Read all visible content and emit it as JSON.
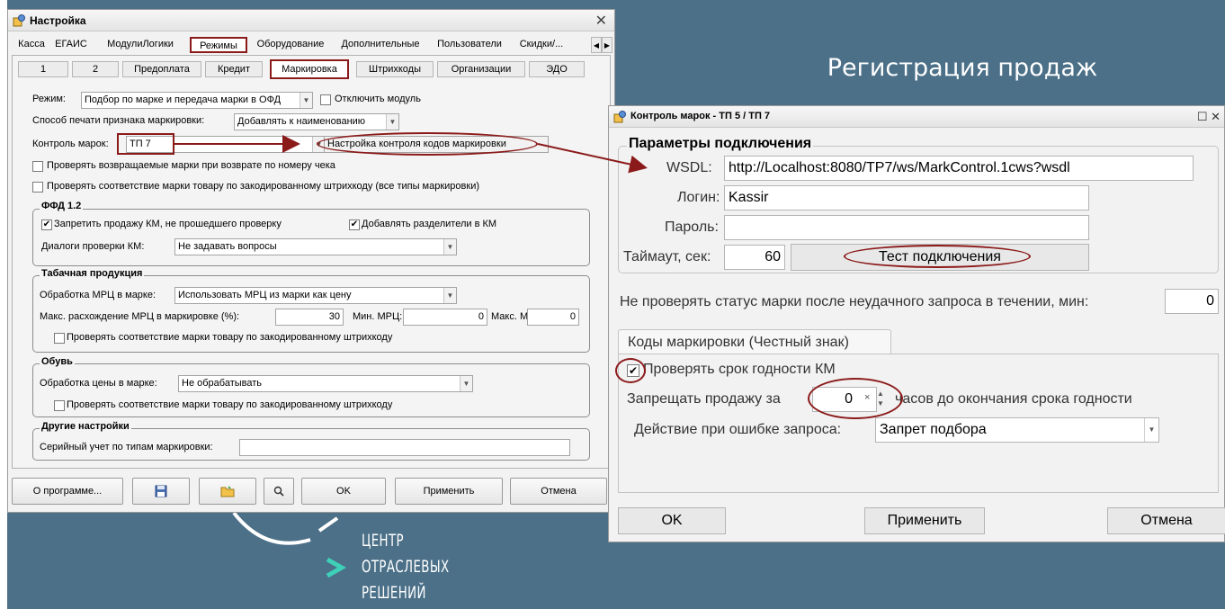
{
  "slide": {
    "title": "Регистрация продаж",
    "logo_lines": [
      "ЦЕНТР",
      "ОТРАСЛЕВЫХ",
      "РЕШЕНИЙ"
    ]
  },
  "settings_window": {
    "title": "Настройка",
    "main_tabs": [
      "Касса",
      "ЕГАИС",
      "МодулиЛогики",
      "Режимы",
      "Оборудование",
      "Дополнительные",
      "Пользователи",
      "Скидки/..."
    ],
    "sub_tabs": [
      "1",
      "2",
      "Предоплата",
      "Кредит",
      "Маркировка",
      "Штрихкоды",
      "Организации",
      "ЭДО"
    ],
    "mode_label": "Режим:",
    "mode_value": "Подбор по марке и передача марки в ОФД",
    "disable_module_label": "Отключить модуль",
    "print_method_label": "Способ печати признака маркировки:",
    "print_method_value": "Добавлять к наименованию",
    "control_label": "Контроль марок:",
    "control_value": "ТП 7",
    "control_settings_button": "Настройка контроля кодов маркировки",
    "check_returned_label": "Проверять возвращаемые марки при возврате по номеру чека",
    "check_match_label": "Проверять соответствие марки товару по закодированному штрихкоду (все типы маркировки)",
    "ffd": {
      "title": "ФФД 1.2",
      "forbid_label": "Запретить продажу КМ, не прошедшего проверку",
      "separators_label": "Добавлять разделители в КМ",
      "dialogs_label": "Диалоги проверки КМ:",
      "dialogs_value": "Не задавать вопросы"
    },
    "tobacco": {
      "title": "Табачная продукция",
      "mrp_label": "Обработка МРЦ в марке:",
      "mrp_value": "Использовать МРЦ из марки как цену",
      "max_diff_label": "Макс. расхождение МРЦ в маркировке (%):",
      "max_diff_value": "30",
      "min_mrp_label": "Мин. МРЦ:",
      "min_mrp_value": "0",
      "max_mrp_label": "Макс. МРЦ:",
      "max_mrp_value": "0",
      "check_label": "Проверять соответствие марки товару по закодированному штрихкоду"
    },
    "shoes": {
      "title": "Обувь",
      "price_label": "Обработка цены в марке:",
      "price_value": "Не обрабатывать",
      "check_label": "Проверять соответствие марки товару по закодированному штрихкоду"
    },
    "other": {
      "title": "Другие настройки",
      "serial_label": "Серийный учет по типам маркировки:",
      "serial_value": ""
    },
    "buttons": {
      "about": "О программе...",
      "ok": "OK",
      "apply": "Применить",
      "cancel": "Отмена"
    }
  },
  "control_window": {
    "title": "Контроль марок - ТП 5 / ТП 7",
    "section_title": "Параметры подключения",
    "wsdl_label": "WSDL:",
    "wsdl_value": "http://Localhost:8080/TP7/ws/MarkControl.1cws?wsdl",
    "login_label": "Логин:",
    "login_value": "Kassir",
    "password_label": "Пароль:",
    "password_value": "",
    "timeout_label": "Таймаут, сек:",
    "timeout_value": "60",
    "test_button": "Тест подключения",
    "no_check_label": "Не проверять статус марки после неудачного запроса в течении, мин:",
    "no_check_value": "0",
    "tab_label": "Коды маркировки (Честный знак)",
    "check_expiry_label": "Проверять срок годности КМ",
    "forbid_label_pre": "Запрещать продажу за",
    "forbid_value": "0",
    "forbid_label_post": "часов до окончания срока годности",
    "error_action_label": "Действие при ошибке запроса:",
    "error_action_value": "Запрет подбора",
    "buttons": {
      "ok": "OK",
      "apply": "Применить",
      "cancel": "Отмена"
    }
  },
  "colors": {
    "slide_bg": "#4b7088",
    "highlight": "#8b1a1a",
    "logo_accent": "#3fd0b8"
  }
}
